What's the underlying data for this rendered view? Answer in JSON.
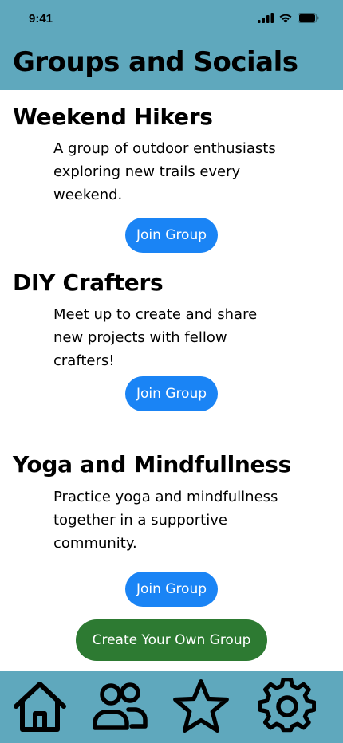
{
  "status_bar": {
    "time": "9:41"
  },
  "header": {
    "title": "Groups and Socials"
  },
  "groups": [
    {
      "title": "Weekend Hikers",
      "description": "A group of outdoor enthusiasts exploring new trails every weekend.",
      "button_label": "Join Group"
    },
    {
      "title": "DIY Crafters",
      "description": "Meet up to create and share new projects with fellow crafters!",
      "button_label": "Join Group"
    },
    {
      "title": "Yoga and Mindfullness",
      "description": "Practice yoga and mindfullness together in a supportive community.",
      "button_label": "Join Group"
    }
  ],
  "create_button_label": "Create Your Own Group",
  "tabbar": {
    "items": [
      "home-icon",
      "groups-icon",
      "favorites-star-icon",
      "settings-gear-icon"
    ]
  },
  "colors": {
    "header_bg": "#5fa8bd",
    "join_button": "#1a84f5",
    "create_button": "#2d7a32"
  }
}
